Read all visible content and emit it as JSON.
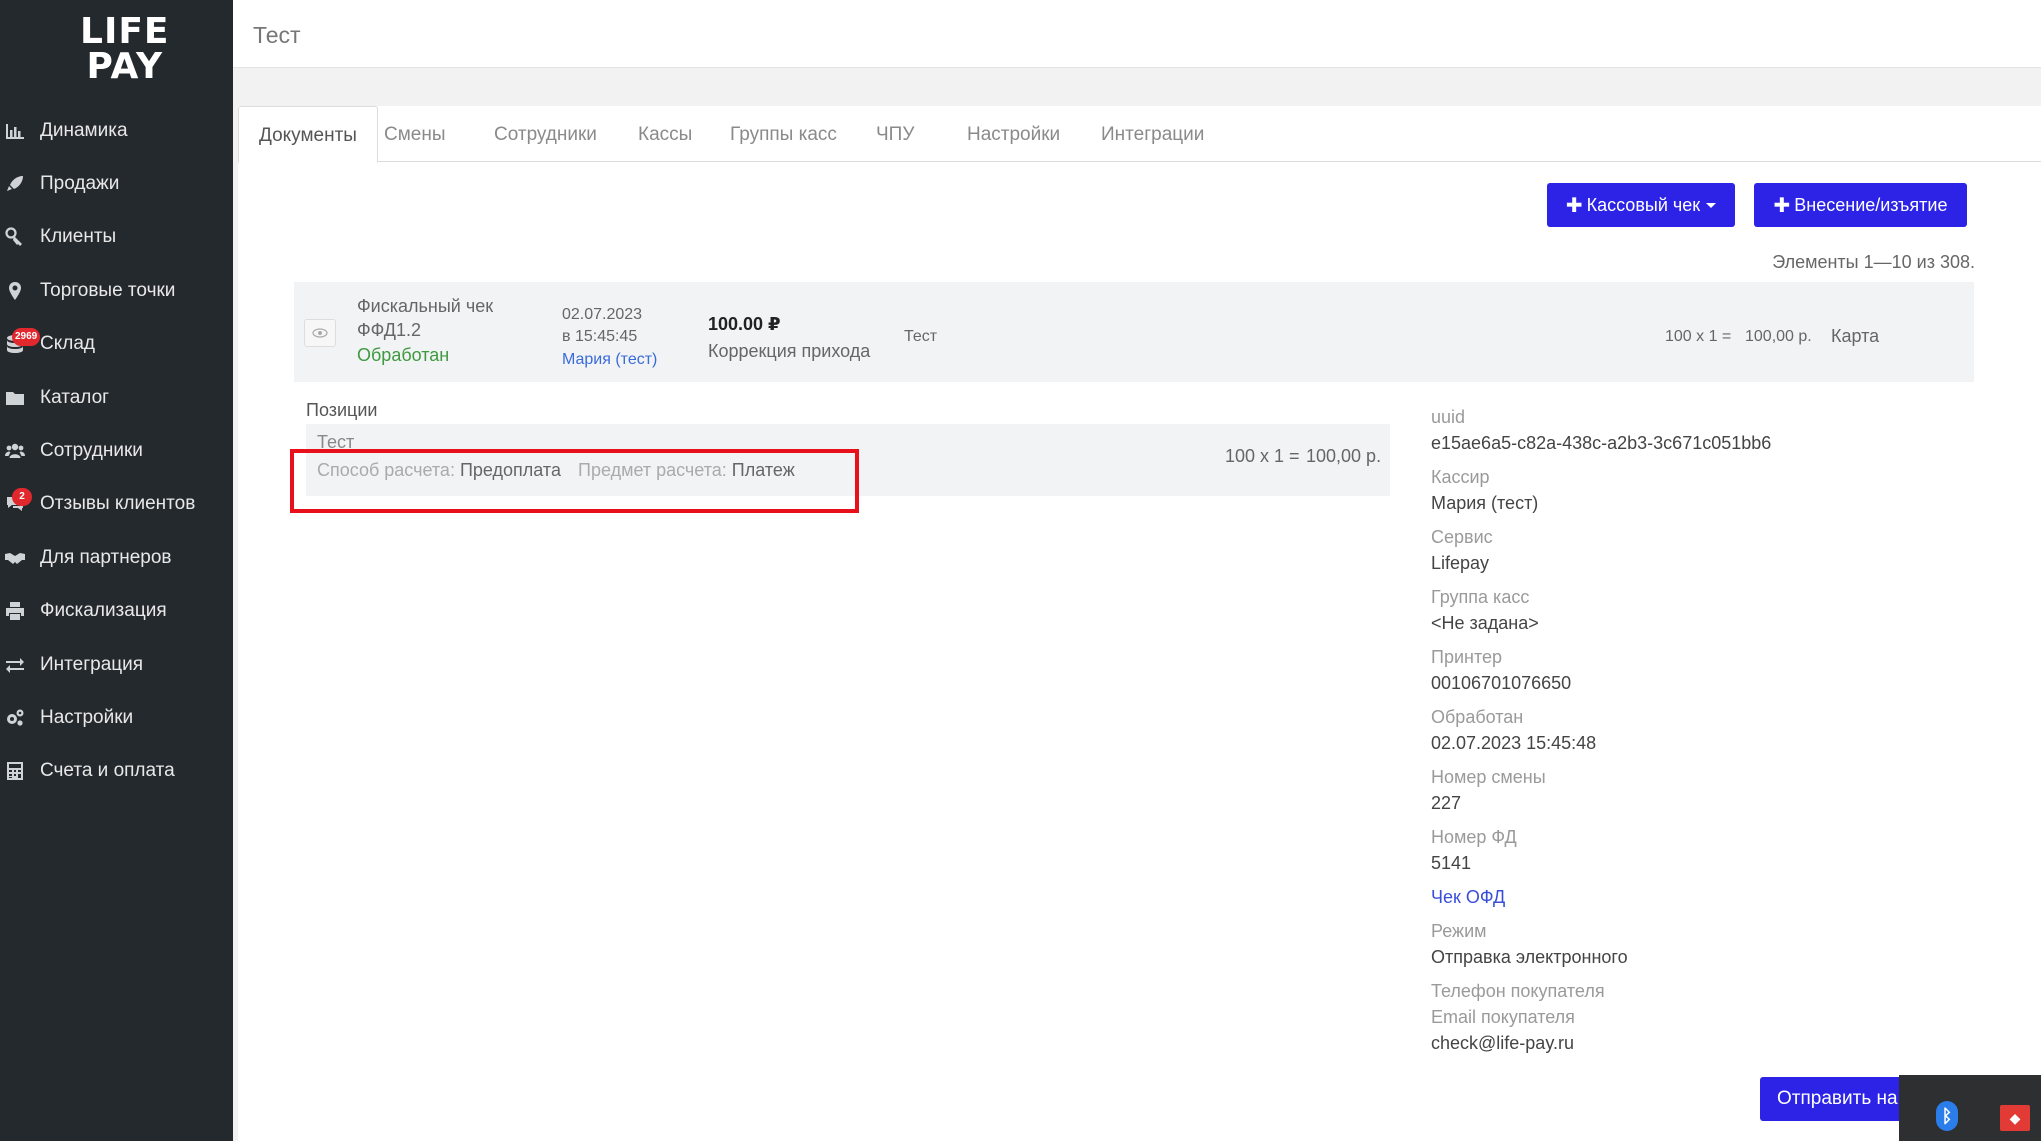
{
  "logo": {
    "line1": "LIFE",
    "line2": "PAY"
  },
  "sidebar": {
    "items": [
      {
        "label": "Динамика",
        "icon": "bar-chart-icon"
      },
      {
        "label": "Продажи",
        "icon": "rocket-icon"
      },
      {
        "label": "Клиенты",
        "icon": "key-icon"
      },
      {
        "label": "Торговые точки",
        "icon": "map-marker-icon"
      },
      {
        "label": "Склад",
        "icon": "database-icon",
        "badge": "2969"
      },
      {
        "label": "Каталог",
        "icon": "folder-icon"
      },
      {
        "label": "Сотрудники",
        "icon": "users-icon"
      },
      {
        "label": "Отзывы клиентов",
        "icon": "comments-icon",
        "badge": "2"
      },
      {
        "label": "Для партнеров",
        "icon": "handshake-icon"
      },
      {
        "label": "Фискализация",
        "icon": "print-icon"
      },
      {
        "label": "Интеграция",
        "icon": "exchange-icon"
      },
      {
        "label": "Настройки",
        "icon": "gears-icon"
      },
      {
        "label": "Счета и оплата",
        "icon": "calculator-icon"
      }
    ]
  },
  "header": {
    "title": "Тест"
  },
  "tabs": [
    {
      "label": "Документы",
      "active": true
    },
    {
      "label": "Смены"
    },
    {
      "label": "Сотрудники"
    },
    {
      "label": "Кассы"
    },
    {
      "label": "Группы касс"
    },
    {
      "label": "ЧПУ"
    },
    {
      "label": "Настройки"
    },
    {
      "label": "Интеграции"
    }
  ],
  "toolbar": {
    "receipt_button": "Кассовый чек",
    "cash_button": "Внесение/изъятие",
    "count_text": "Элементы 1—10 из 308."
  },
  "document": {
    "type_line1": "Фискальный чек",
    "type_line2": "ФФД1.2",
    "status": "Обработан",
    "date": "02.07.2023",
    "time": "в 15:45:45",
    "cashier": "Мария (тест)",
    "amount": "100.00 ₽",
    "operation": "Коррекция прихода",
    "name": "Тест",
    "formula": "100 x 1 =",
    "sum": "100,00 р.",
    "payment": "Карта"
  },
  "positions": {
    "title": "Позиции",
    "item_name": "Тест",
    "method_label": "Способ расчета:",
    "method_value": "Предоплата",
    "subject_label": "Предмет расчета:",
    "subject_value": "Платеж",
    "formula": "100 x 1 =",
    "sum": "100,00 р."
  },
  "details": {
    "uuid_label": "uuid",
    "uuid_value": "e15ae6a5-c82a-438c-a2b3-3c671c051bb6",
    "cashier_label": "Кассир",
    "cashier_value": "Мария (тест)",
    "service_label": "Сервис",
    "service_value": "Lifepay",
    "group_label": "Группа касс",
    "group_value": "<Не задана>",
    "printer_label": "Принтер",
    "printer_value": "00106701076650",
    "processed_label": "Обработан",
    "processed_value": "02.07.2023 15:45:48",
    "shift_label": "Номер смены",
    "shift_value": "227",
    "fd_label": "Номер ФД",
    "fd_value": "5141",
    "ofd_link": "Чек ОФД",
    "mode_label": "Режим",
    "mode_value": "Отправка электронного",
    "phone_label": "Телефон покупателя",
    "email_label": "Email покупателя",
    "email_value": "check@life-pay.ru"
  },
  "send_button": "Отправить на",
  "colors": {
    "sidebar_bg": "#24292e",
    "accent": "#2c23e6",
    "status_ok": "#3e9a3e",
    "highlight": "#e8101a"
  }
}
